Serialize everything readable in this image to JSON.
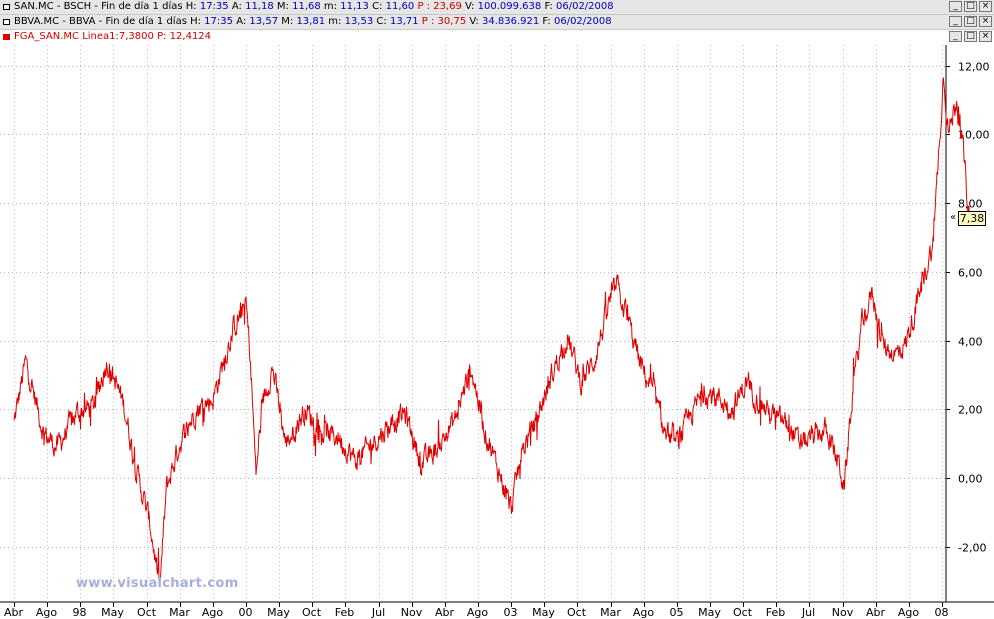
{
  "header": {
    "row1": {
      "symbol": "SAN.MC - BSCH",
      "period": "Fin de día 1 días",
      "h_label": "H:",
      "h_value": "17:35",
      "a_label": "A:",
      "a_value": "11,18",
      "m_label": "M:",
      "m_value": "11,68",
      "min_label": "m:",
      "min_value": "11,13",
      "c_label": "C:",
      "c_value": "11,60",
      "p_label": "P :",
      "p_value": "23,69",
      "v_label": "V:",
      "v_value": "100.099.638",
      "f_label": "F:",
      "f_value": "06/02/2008"
    },
    "row2": {
      "symbol": "BBVA.MC - BBVA",
      "period": "Fin de día 1 días",
      "h_label": "H:",
      "h_value": "17:35",
      "a_label": "A:",
      "a_value": "13,57",
      "m_label": "M:",
      "m_value": "13,81",
      "min_label": "m:",
      "min_value": "13,53",
      "c_label": "C:",
      "c_value": "13,71",
      "p_label": "P :",
      "p_value": "30,75",
      "v_label": "V:",
      "v_value": "34.836.921",
      "f_label": "F:",
      "f_value": "06/02/2008"
    },
    "row3": {
      "indicator": "FGA_SAN.MC",
      "line_label": "Linea1:",
      "line_value": "7,3800",
      "p_label": "P:",
      "p_value": "12,4124"
    },
    "window_buttons": [
      "_",
      "□",
      "×"
    ]
  },
  "watermark": "www.visualchart.com",
  "last_value_label": "7,38",
  "chart_data": {
    "type": "line",
    "series": [
      {
        "name": "Linea1",
        "color": "#e00000"
      }
    ],
    "ylim": [
      -3.6,
      12.6
    ],
    "y_ticks": [
      "12,00",
      "10,00",
      "8,00",
      "6,00",
      "4,00",
      "2,00",
      "0,00",
      "-2,00"
    ],
    "y_tick_values": [
      12,
      10,
      8,
      6,
      4,
      2,
      0,
      -2
    ],
    "x_tick_labels": [
      "Abr",
      "Ago",
      "98",
      "May",
      "Oct",
      "Mar",
      "Ago",
      "00",
      "May",
      "Oct",
      "Feb",
      "Jul",
      "Nov",
      "Abr",
      "Ago",
      "03",
      "May",
      "Oct",
      "Mar",
      "Ago",
      "05",
      "May",
      "Oct",
      "Feb",
      "Jul",
      "Nov",
      "Abr",
      "Ago",
      "08"
    ],
    "x_tick_index": [
      0,
      1,
      2,
      3,
      4,
      5,
      6,
      7,
      8,
      9,
      10,
      11,
      12,
      13,
      14,
      15,
      16,
      17,
      18,
      19,
      20,
      21,
      22,
      23,
      24,
      25,
      26,
      27,
      28
    ],
    "grid": "dotted",
    "last_value": 7.38,
    "anchors": [
      [
        0,
        1.6
      ],
      [
        0.35,
        3.4
      ],
      [
        0.9,
        1.3
      ],
      [
        1.3,
        0.9
      ],
      [
        1.9,
        1.9
      ],
      [
        2.4,
        2.1
      ],
      [
        2.8,
        3.4
      ],
      [
        3.3,
        2.2
      ],
      [
        3.7,
        0.2
      ],
      [
        4.1,
        -1.3
      ],
      [
        4.4,
        -3.2
      ],
      [
        4.6,
        -0.3
      ],
      [
        5.0,
        1.0
      ],
      [
        5.5,
        2.0
      ],
      [
        6.0,
        2.3
      ],
      [
        6.6,
        4.3
      ],
      [
        7.0,
        5.1
      ],
      [
        7.15,
        3.2
      ],
      [
        7.3,
        0.1
      ],
      [
        7.5,
        2.2
      ],
      [
        7.8,
        3.2
      ],
      [
        8.2,
        1.0
      ],
      [
        8.8,
        2.0
      ],
      [
        9.3,
        1.3
      ],
      [
        9.8,
        1.2
      ],
      [
        10.3,
        0.5
      ],
      [
        10.8,
        1.0
      ],
      [
        11.3,
        1.5
      ],
      [
        11.8,
        1.9
      ],
      [
        12.3,
        0.4
      ],
      [
        12.8,
        0.9
      ],
      [
        13.3,
        1.7
      ],
      [
        13.8,
        3.2
      ],
      [
        14.2,
        1.4
      ],
      [
        14.7,
        0.0
      ],
      [
        15.0,
        -0.9
      ],
      [
        15.3,
        0.7
      ],
      [
        15.8,
        1.8
      ],
      [
        16.3,
        3.2
      ],
      [
        16.7,
        4.1
      ],
      [
        17.1,
        2.8
      ],
      [
        17.5,
        3.4
      ],
      [
        18.0,
        5.2
      ],
      [
        18.2,
        5.6
      ],
      [
        18.5,
        4.7
      ],
      [
        18.9,
        3.3
      ],
      [
        19.3,
        2.5
      ],
      [
        19.6,
        1.4
      ],
      [
        20.0,
        1.0
      ],
      [
        20.4,
        1.8
      ],
      [
        20.8,
        2.5
      ],
      [
        21.3,
        2.3
      ],
      [
        21.7,
        2.0
      ],
      [
        22.1,
        2.8
      ],
      [
        22.5,
        2.2
      ],
      [
        22.9,
        1.8
      ],
      [
        23.3,
        1.6
      ],
      [
        23.7,
        1.0
      ],
      [
        24.1,
        1.2
      ],
      [
        24.5,
        1.4
      ],
      [
        24.9,
        0.4
      ],
      [
        25.05,
        -0.3
      ],
      [
        25.3,
        2.5
      ],
      [
        25.6,
        4.6
      ],
      [
        25.9,
        5.4
      ],
      [
        26.2,
        3.9
      ],
      [
        26.6,
        3.6
      ],
      [
        26.9,
        3.9
      ],
      [
        27.2,
        4.9
      ],
      [
        27.5,
        6.0
      ],
      [
        27.75,
        6.9
      ],
      [
        27.9,
        9.5
      ],
      [
        28.05,
        11.8
      ],
      [
        28.2,
        10.0
      ],
      [
        28.45,
        11.1
      ],
      [
        28.65,
        9.4
      ],
      [
        28.85,
        7.4
      ]
    ]
  }
}
